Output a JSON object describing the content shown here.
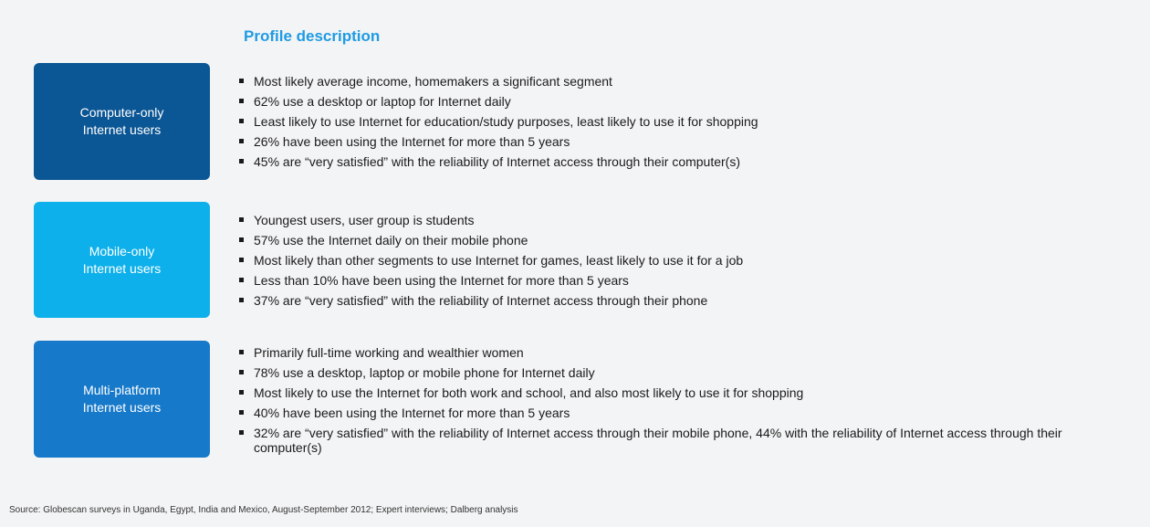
{
  "heading": "Profile description",
  "segments": [
    {
      "label": "Computer-only\nInternet users",
      "color": "#0b5694",
      "bullets": [
        "Most likely average income, homemakers a significant segment",
        "62% use a desktop or laptop for Internet daily",
        "Least likely to use Internet for education/study purposes, least likely to use it for shopping",
        "26% have been using the Internet for more than 5 years",
        "45% are “very satisfied” with the reliability of Internet access through their computer(s)"
      ]
    },
    {
      "label": "Mobile-only\nInternet users",
      "color": "#0db0ea",
      "bullets": [
        "Youngest users, user group is students",
        "57% use the Internet daily on their mobile phone",
        "Most likely than other segments to use Internet for games, least likely to use it for a job",
        "Less than 10% have been using the Internet for more than 5 years",
        "37% are “very satisfied” with the reliability of Internet access through their phone"
      ]
    },
    {
      "label": "Multi-platform\nInternet users",
      "color": "#1679c9",
      "bullets": [
        "Primarily full-time working and wealthier women",
        "78% use a desktop, laptop or mobile phone for Internet daily",
        "Most likely to use the Internet for both work and school, and also most likely to use it for shopping",
        "40% have been using the Internet for more than 5 years",
        "32% are “very satisfied” with the reliability of Internet access through their mobile phone, 44%  with the reliability of Internet access through their computer(s)"
      ]
    }
  ],
  "source": "Source: Globescan surveys in Uganda, Egypt, India and Mexico, August-September 2012; Expert interviews; Dalberg analysis"
}
